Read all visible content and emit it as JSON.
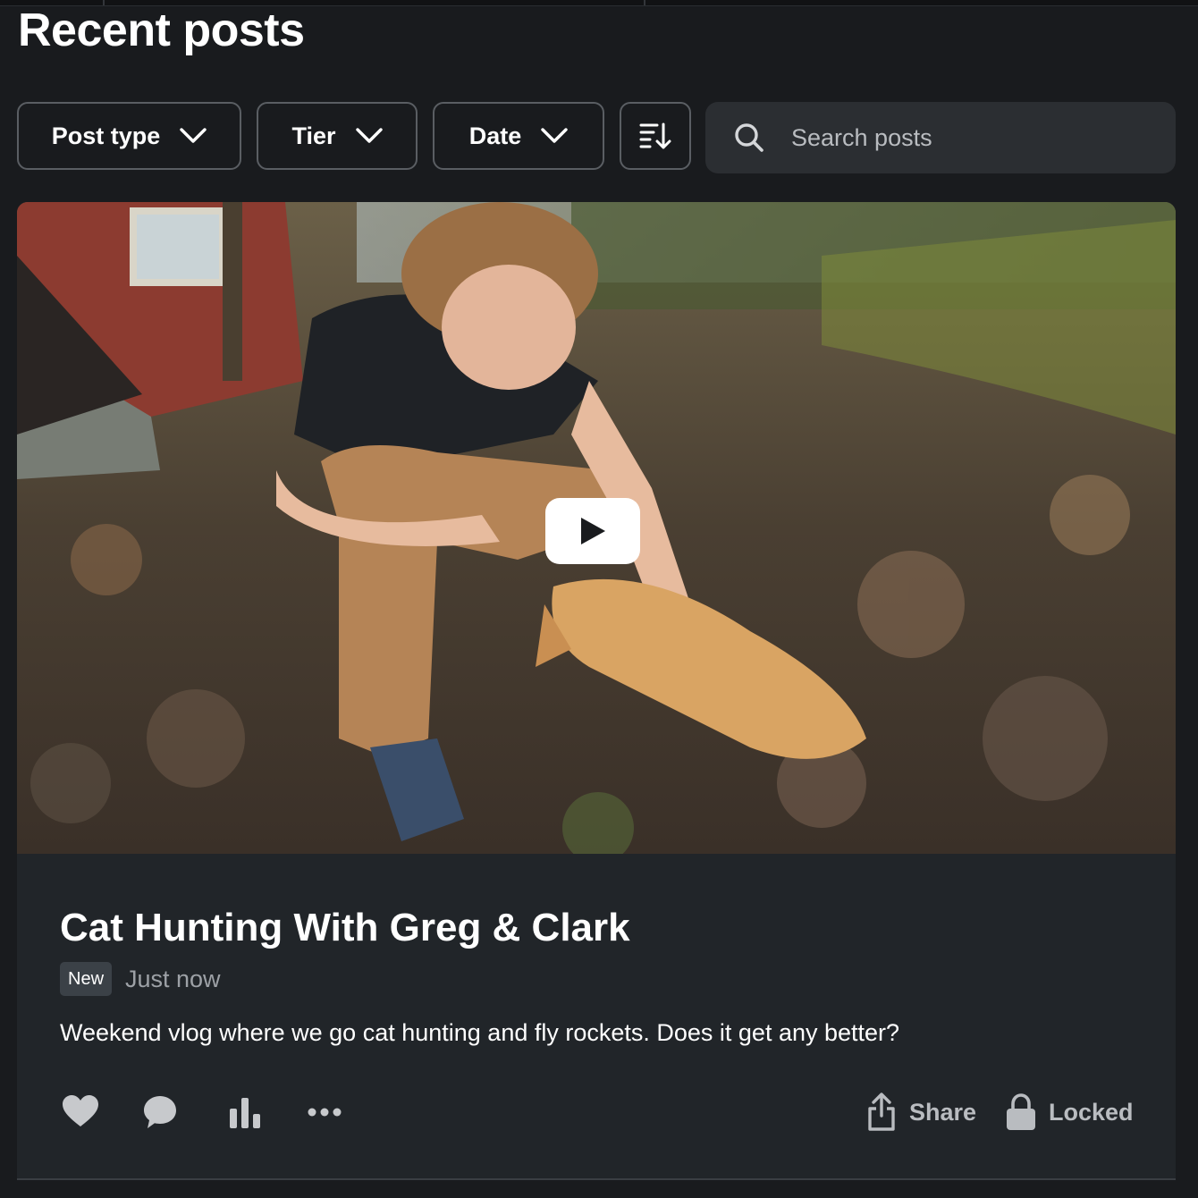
{
  "page": {
    "title": "Recent posts"
  },
  "filters": {
    "post_type_label": "Post type",
    "tier_label": "Tier",
    "date_label": "Date",
    "sort_icon": "sort-descending-icon",
    "search_placeholder": "Search posts",
    "search_icon": "search-icon"
  },
  "post": {
    "title": "Cat Hunting With Greg & Clark",
    "badge": "New",
    "time": "Just now",
    "description": "Weekend vlog where we go cat hunting and fly rockets. Does it get any better?",
    "media": {
      "type": "video",
      "play_icon": "play-icon"
    },
    "actions": {
      "like_icon": "heart-icon",
      "comment_icon": "comment-icon",
      "stats_icon": "bar-chart-icon",
      "more_icon": "more-dots-icon",
      "share_label": "Share",
      "share_icon": "share-icon",
      "locked_label": "Locked",
      "locked_icon": "lock-icon"
    }
  },
  "colors": {
    "background": "#191b1e",
    "card": "#212529",
    "search_bg": "#2b2e32",
    "muted_text": "#9da1a6",
    "action_gray": "#b9bcc0"
  }
}
